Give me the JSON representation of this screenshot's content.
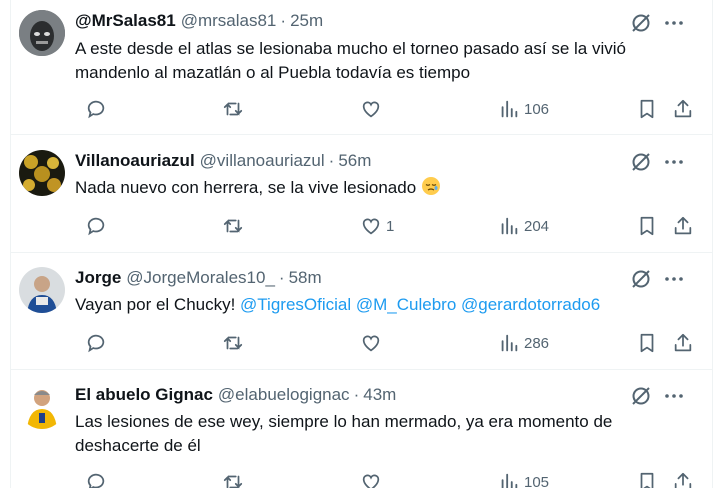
{
  "tweets": [
    {
      "name": "@MrSalas81",
      "handle": "@mrsalas81",
      "time": "25m",
      "text": "A este desde el atlas se lesionaba mucho el torneo pasado así se la vivió mandenlo al mazatlán o al Puebla todavía es tiempo",
      "likes": "",
      "views": "106",
      "avatar": "masked-face-avatar"
    },
    {
      "name": "Villanoauriazul",
      "handle": "@villanoauriazul",
      "time": "56m",
      "text": "Nada nuevo con herrera, se la vive lesionado",
      "likes": "1",
      "views": "204",
      "avatar": "gold-pattern-avatar"
    },
    {
      "name": "Jorge",
      "handle": "@JorgeMorales10_",
      "time": "58m",
      "text_prefix": "Vayan por el Chucky! ",
      "mentions": [
        "@TigresOficial",
        "@M_Culebro",
        "@gerardotorrado6"
      ],
      "likes": "",
      "views": "286",
      "avatar": "person-photo-avatar"
    },
    {
      "name": "El abuelo Gignac",
      "handle": "@elabuelogignac",
      "time": "43m",
      "text": "Las lesiones de ese wey, siempre lo han mermado, ya era momento de deshacerte de él",
      "likes": "",
      "views": "105",
      "avatar": "player-avatar"
    }
  ],
  "separator": "·",
  "icons": {
    "reply": "reply-icon",
    "retweet": "retweet-icon",
    "like": "heart-icon",
    "views": "views-chart-icon",
    "bookmark": "bookmark-icon",
    "share": "share-icon",
    "grok": "grok-icon",
    "more": "more-icon",
    "emoji": "sad-face-emoji"
  },
  "colors": {
    "text": "#0f1419",
    "secondary": "#536471",
    "link": "#1d9bf0",
    "border": "#eff3f4"
  }
}
